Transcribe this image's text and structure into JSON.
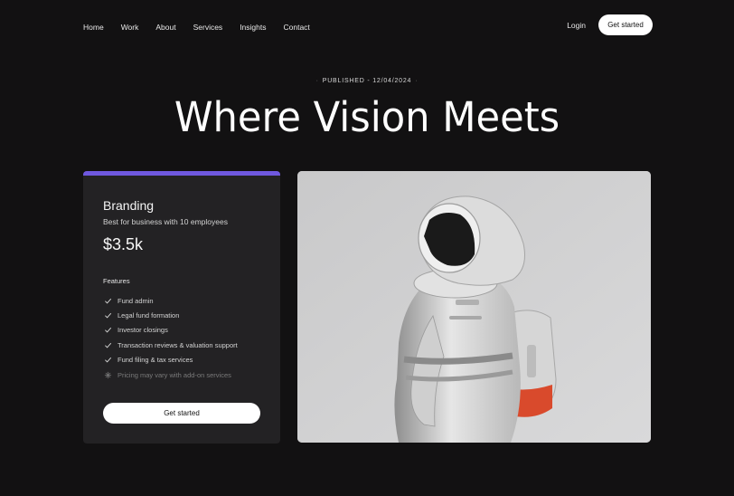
{
  "nav": {
    "links": [
      "Home",
      "Work",
      "About",
      "Services",
      "Insights",
      "Contact"
    ],
    "login": "Login",
    "cta": "Get started"
  },
  "hero": {
    "published": "PUBLISHED - 12/04/2024",
    "title": "Where Vision Meets"
  },
  "card": {
    "accent_color": "#6f58df",
    "title": "Branding",
    "subtitle": "Best for business with 10 employees",
    "price": "$3.5k",
    "features_label": "Features",
    "features": [
      "Fund admin",
      "Legal fund formation",
      "Investor closings",
      "Transaction reviews & valuation support",
      "Fund filing & tax services"
    ],
    "note": "Pricing may vary with add-on services",
    "cta": "Get started"
  },
  "image": {
    "subject_icon": "astronaut-photo"
  }
}
